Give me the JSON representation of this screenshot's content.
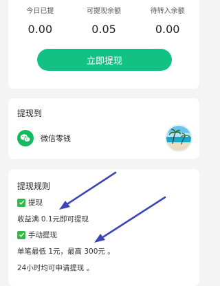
{
  "balance": {
    "stats": [
      {
        "label": "今日已提",
        "value": "0.00"
      },
      {
        "label": "可提现余额",
        "value": "0.05"
      },
      {
        "label": "待转入余额",
        "value": "0.00"
      }
    ],
    "withdraw_button": "立即提现"
  },
  "target": {
    "title": "提现到",
    "method_label": "微信零钱",
    "method_icon": "wechat-icon",
    "avatar_icon": "avatar-beach-image"
  },
  "rules": {
    "title": "提现规则",
    "items": [
      {
        "text": "提现",
        "checked": true
      },
      {
        "text": "收益满 0.1元即可提现",
        "checked": false
      },
      {
        "text": "手动提现",
        "checked": true
      },
      {
        "text": "单笔最低 1元，最高 300元 。",
        "checked": false
      },
      {
        "text": "24小时均可申请提现 。",
        "checked": false
      }
    ]
  },
  "colors": {
    "accent": "#14c184",
    "wechat": "#15b95e",
    "check": "#33b84a",
    "annotation_arrow": "#3d45b6"
  }
}
